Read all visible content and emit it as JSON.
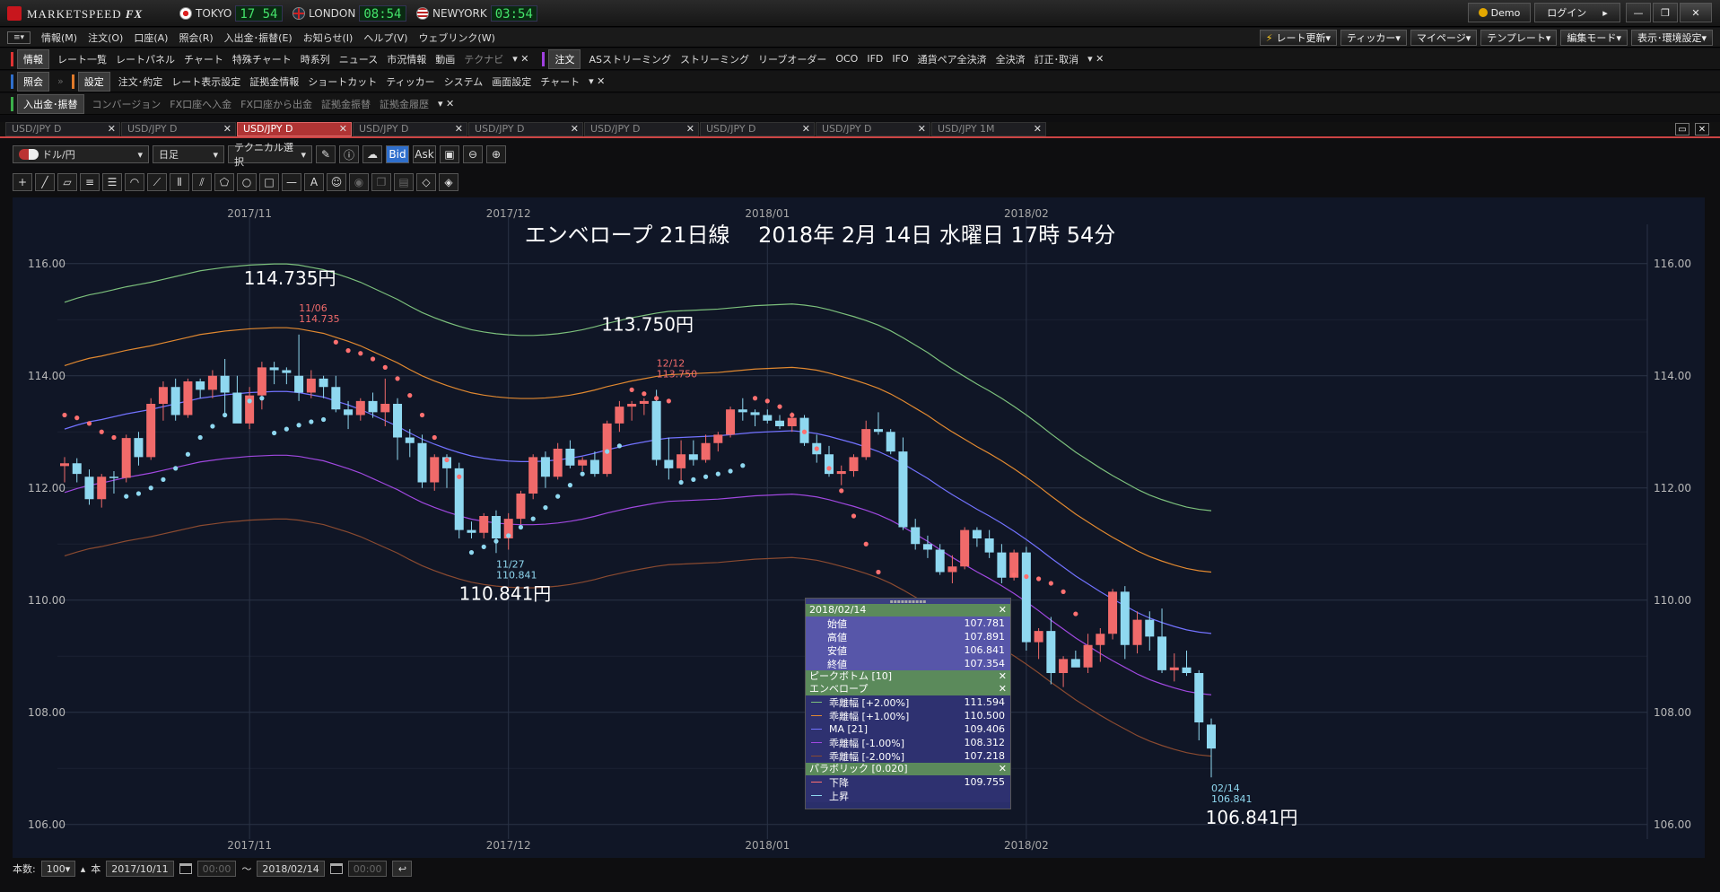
{
  "app": {
    "brand": "MARKETSPEED",
    "brand_suffix": "FX",
    "clocks": [
      {
        "city": "TOKYO",
        "time": "17 54",
        "flag": "japan-flag-icon"
      },
      {
        "city": "LONDON",
        "time": "08:54",
        "flag": "uk-flag-icon"
      },
      {
        "city": "NEWYORK",
        "time": "03:54",
        "flag": "us-flag-icon"
      }
    ],
    "demo_label": "Demo",
    "login_label": "ログイン"
  },
  "menu": {
    "items": [
      "情報(M)",
      "注文(O)",
      "口座(A)",
      "照会(R)",
      "入出金･振替(E)",
      "お知らせ(I)",
      "ヘルプ(V)",
      "ウェブリンク(W)"
    ],
    "right": [
      "レート更新",
      "ティッカー",
      "マイページ",
      "テンプレート",
      "編集モード",
      "表示･環境設定"
    ]
  },
  "toolbar1": {
    "group1": "情報",
    "items1": [
      "レート一覧",
      "レートパネル",
      "チャート",
      "特殊チャート",
      "時系列",
      "ニュース",
      "市況情報",
      "動画",
      "テクナビ"
    ],
    "group2": "注文",
    "items2": [
      "ASストリーミング",
      "ストリーミング",
      "リーブオーダー",
      "OCO",
      "IFD",
      "IFO",
      "通貨ペア全決済",
      "全決済",
      "訂正･取消"
    ]
  },
  "toolbar2": {
    "group1": "照会",
    "group2": "設定",
    "items": [
      "注文･約定",
      "レート表示設定",
      "証拠金情報",
      "ショートカット",
      "ティッカー",
      "システム",
      "画面設定",
      "チャート"
    ]
  },
  "toolbar3": {
    "group1": "入出金･振替",
    "items": [
      "コンバージョン",
      "FX口座へ入金",
      "FX口座から出金",
      "証拠金振替",
      "証拠金履歴"
    ]
  },
  "tabs": [
    {
      "label": "USD/JPY D",
      "active": false
    },
    {
      "label": "USD/JPY D",
      "active": false
    },
    {
      "label": "USD/JPY D",
      "active": true
    },
    {
      "label": "USD/JPY D",
      "active": false
    },
    {
      "label": "USD/JPY D",
      "active": false
    },
    {
      "label": "USD/JPY D",
      "active": false
    },
    {
      "label": "USD/JPY D",
      "active": false
    },
    {
      "label": "USD/JPY D",
      "active": false
    },
    {
      "label": "USD/JPY 1M",
      "active": false
    }
  ],
  "chart_toolbar": {
    "pair": "ドル/円",
    "period": "日足",
    "technical": "テクニカル選択",
    "bid": "Bid",
    "ask": "Ask"
  },
  "chart_data": {
    "type": "candlestick",
    "title": "エンベロープ 21日線　 2018年 2月 14日 水曜日 17時 54分",
    "x_ticks": [
      "2017/11",
      "2017/12",
      "2018/01",
      "2018/02"
    ],
    "y_ticks": [
      "116.00",
      "114.00",
      "112.00",
      "110.00",
      "108.00",
      "106.00"
    ],
    "ylim": [
      105.5,
      116.7
    ],
    "annotations": [
      {
        "text": "114.735円",
        "kind": "big"
      },
      {
        "text": "113.750円",
        "kind": "big"
      },
      {
        "text": "110.841円",
        "kind": "big"
      },
      {
        "text": "106.841円",
        "kind": "big"
      },
      {
        "text": "11/06",
        "value": "114.735"
      },
      {
        "text": "12/12",
        "value": "113.750"
      },
      {
        "text": "11/27",
        "value": "110.841"
      },
      {
        "text": "02/14",
        "value": "106.841"
      }
    ],
    "series_colors": {
      "up": "#f06a6a",
      "down": "#8fd8f0",
      "ma": "#7272ff",
      "env_p2": "#7cc07c",
      "env_p1": "#e08830",
      "env_m1": "#a048e0",
      "env_m2": "#8a4a30",
      "psar_up": "#8fd8f0",
      "psar_down": "#ff7070"
    },
    "ohlc": [
      [
        112.39,
        112.55,
        112.1,
        112.44
      ],
      [
        112.44,
        112.53,
        112.1,
        112.25
      ],
      [
        112.2,
        112.33,
        111.7,
        111.8
      ],
      [
        111.8,
        112.25,
        111.65,
        112.2
      ],
      [
        112.2,
        112.3,
        111.9,
        112.18
      ],
      [
        112.18,
        112.95,
        112.1,
        112.89
      ],
      [
        112.89,
        113.0,
        112.4,
        112.55
      ],
      [
        112.55,
        113.6,
        112.5,
        113.5
      ],
      [
        113.5,
        113.9,
        113.2,
        113.8
      ],
      [
        113.8,
        113.95,
        113.2,
        113.3
      ],
      [
        113.3,
        113.95,
        113.25,
        113.9
      ],
      [
        113.9,
        113.95,
        113.6,
        113.75
      ],
      [
        113.75,
        114.1,
        113.6,
        114.0
      ],
      [
        114.0,
        114.3,
        113.3,
        113.7
      ],
      [
        113.7,
        114.0,
        113.4,
        113.15
      ],
      [
        113.15,
        113.8,
        113.05,
        113.65
      ],
      [
        113.65,
        114.25,
        113.4,
        114.15
      ],
      [
        114.15,
        114.25,
        113.85,
        114.1
      ],
      [
        114.1,
        114.15,
        113.85,
        114.05
      ],
      [
        114.0,
        114.735,
        113.55,
        113.7
      ],
      [
        113.7,
        114.1,
        113.6,
        113.95
      ],
      [
        113.95,
        114.0,
        113.6,
        113.8
      ],
      [
        113.8,
        114.0,
        113.35,
        113.4
      ],
      [
        113.4,
        113.55,
        113.05,
        113.3
      ],
      [
        113.3,
        113.6,
        113.2,
        113.55
      ],
      [
        113.55,
        113.7,
        113.25,
        113.35
      ],
      [
        113.35,
        113.95,
        113.1,
        113.5
      ],
      [
        113.5,
        113.6,
        112.5,
        112.9
      ],
      [
        112.9,
        113.05,
        112.55,
        112.8
      ],
      [
        112.8,
        112.95,
        112.0,
        112.1
      ],
      [
        112.1,
        112.6,
        111.95,
        112.55
      ],
      [
        112.55,
        112.6,
        112.0,
        112.35
      ],
      [
        112.35,
        112.45,
        111.1,
        111.25
      ],
      [
        111.25,
        111.4,
        111.1,
        111.2
      ],
      [
        111.2,
        111.55,
        111.1,
        111.5
      ],
      [
        111.5,
        111.6,
        110.84,
        111.1
      ],
      [
        111.1,
        111.55,
        110.9,
        111.45
      ],
      [
        111.45,
        111.95,
        111.35,
        111.9
      ],
      [
        111.9,
        112.6,
        111.8,
        112.55
      ],
      [
        112.55,
        112.65,
        112.0,
        112.2
      ],
      [
        112.2,
        112.8,
        112.15,
        112.7
      ],
      [
        112.7,
        112.85,
        112.35,
        112.4
      ],
      [
        112.4,
        112.55,
        112.3,
        112.5
      ],
      [
        112.5,
        112.65,
        112.2,
        112.25
      ],
      [
        112.25,
        113.2,
        112.2,
        113.15
      ],
      [
        113.15,
        113.55,
        113.0,
        113.45
      ],
      [
        113.45,
        113.55,
        113.2,
        113.5
      ],
      [
        113.5,
        113.6,
        113.3,
        113.55
      ],
      [
        113.55,
        113.75,
        112.4,
        112.5
      ],
      [
        112.5,
        112.9,
        112.15,
        112.35
      ],
      [
        112.35,
        112.85,
        112.1,
        112.6
      ],
      [
        112.6,
        112.85,
        112.4,
        112.5
      ],
      [
        112.5,
        112.95,
        112.45,
        112.8
      ],
      [
        112.8,
        113.0,
        112.65,
        112.95
      ],
      [
        112.95,
        113.45,
        112.9,
        113.4
      ],
      [
        113.4,
        113.6,
        113.2,
        113.35
      ],
      [
        113.35,
        113.4,
        113.1,
        113.3
      ],
      [
        113.3,
        113.4,
        113.15,
        113.2
      ],
      [
        113.2,
        113.3,
        113.05,
        113.1
      ],
      [
        113.1,
        113.35,
        113.0,
        113.25
      ],
      [
        113.25,
        113.3,
        112.75,
        112.8
      ],
      [
        112.8,
        112.95,
        112.45,
        112.6
      ],
      [
        112.6,
        112.75,
        112.2,
        112.25
      ],
      [
        112.25,
        112.4,
        112.05,
        112.3
      ],
      [
        112.3,
        112.6,
        112.2,
        112.55
      ],
      [
        112.55,
        113.2,
        112.5,
        113.05
      ],
      [
        113.05,
        113.35,
        112.95,
        113.0
      ],
      [
        113.0,
        113.05,
        112.6,
        112.65
      ],
      [
        112.65,
        112.9,
        111.25,
        111.3
      ],
      [
        111.3,
        111.45,
        110.9,
        111.0
      ],
      [
        111.0,
        111.15,
        110.75,
        110.9
      ],
      [
        110.9,
        111.0,
        110.45,
        110.5
      ],
      [
        110.5,
        110.8,
        110.3,
        110.6
      ],
      [
        110.6,
        111.3,
        110.55,
        111.25
      ],
      [
        111.25,
        111.3,
        110.95,
        111.1
      ],
      [
        111.1,
        111.25,
        110.75,
        110.85
      ],
      [
        110.85,
        111.0,
        110.3,
        110.4
      ],
      [
        110.4,
        110.9,
        110.35,
        110.85
      ],
      [
        110.85,
        110.95,
        109.1,
        109.25
      ],
      [
        109.25,
        109.5,
        108.95,
        109.45
      ],
      [
        109.45,
        109.7,
        108.5,
        108.7
      ],
      [
        108.7,
        109.0,
        108.45,
        108.95
      ],
      [
        108.95,
        109.1,
        108.85,
        108.8
      ],
      [
        108.8,
        109.4,
        108.7,
        109.2
      ],
      [
        109.2,
        109.5,
        108.9,
        109.4
      ],
      [
        109.4,
        110.2,
        109.3,
        110.15
      ],
      [
        110.15,
        110.25,
        108.95,
        109.2
      ],
      [
        109.2,
        109.8,
        109.05,
        109.65
      ],
      [
        109.65,
        109.8,
        109.1,
        109.35
      ],
      [
        109.35,
        109.85,
        108.7,
        108.75
      ],
      [
        108.75,
        109.05,
        108.55,
        108.8
      ],
      [
        108.8,
        109.1,
        108.65,
        108.7
      ],
      [
        108.7,
        108.75,
        107.5,
        107.82
      ],
      [
        107.781,
        107.891,
        106.841,
        107.354
      ]
    ],
    "ma21": [
      113.05,
      113.12,
      113.18,
      113.22,
      113.27,
      113.32,
      113.36,
      113.4,
      113.45,
      113.5,
      113.55,
      113.6,
      113.63,
      113.66,
      113.68,
      113.7,
      113.71,
      113.72,
      113.72,
      113.7,
      113.66,
      113.62,
      113.55,
      113.48,
      113.4,
      113.3,
      113.2,
      113.1,
      112.98,
      112.87,
      112.78,
      112.7,
      112.63,
      112.57,
      112.53,
      112.5,
      112.48,
      112.47,
      112.47,
      112.48,
      112.5,
      112.53,
      112.57,
      112.62,
      112.68,
      112.73,
      112.78,
      112.82,
      112.86,
      112.89,
      112.9,
      112.91,
      112.92,
      112.93,
      112.95,
      112.97,
      112.99,
      113.0,
      113.01,
      113.02,
      113.0,
      112.97,
      112.92,
      112.86,
      112.8,
      112.73,
      112.65,
      112.55,
      112.43,
      112.3,
      112.17,
      112.02,
      111.88,
      111.75,
      111.62,
      111.5,
      111.37,
      111.23,
      111.08,
      110.92,
      110.75,
      110.59,
      110.43,
      110.29,
      110.15,
      110.02,
      109.9,
      109.78,
      109.68,
      109.6,
      109.53,
      109.47,
      109.43,
      109.406
    ],
    "psar": [
      {
        "side": "down",
        "values": [
          113.3,
          113.25,
          113.15,
          113.0,
          112.9
        ]
      },
      {
        "side": "up",
        "values": [
          111.85,
          111.9,
          112.0,
          112.15,
          112.35,
          112.6,
          112.9,
          113.1,
          113.3,
          113.45,
          113.55,
          113.6
        ]
      },
      {
        "side": "up",
        "values": [
          112.98,
          113.05,
          113.12,
          113.18,
          113.22
        ]
      },
      {
        "side": "down",
        "values": [
          114.6,
          114.45,
          114.4,
          114.3,
          114.15,
          113.95,
          113.65,
          113.3,
          112.9,
          112.5,
          112.2
        ]
      },
      {
        "side": "up",
        "values": [
          110.85,
          110.95,
          111.05,
          111.15,
          111.3,
          111.45,
          111.65,
          111.85,
          112.05,
          112.25,
          112.45,
          112.65,
          112.75
        ]
      },
      {
        "side": "down",
        "values": [
          113.75,
          113.68,
          113.6,
          113.55
        ]
      },
      {
        "side": "up",
        "values": [
          112.1,
          112.15,
          112.2,
          112.25,
          112.3,
          112.4
        ]
      },
      {
        "side": "down",
        "values": [
          113.6,
          113.55,
          113.45,
          113.3,
          113.0,
          112.7,
          112.35,
          111.95,
          111.5,
          111.0,
          110.5,
          110.0,
          109.6,
          109.35
        ]
      },
      {
        "side": "up",
        "values": [
          108.3,
          108.4,
          108.5,
          108.7,
          108.85,
          109.05,
          109.2
        ]
      },
      {
        "side": "down",
        "values": [
          110.45,
          110.42,
          110.38,
          110.3,
          110.15,
          109.755
        ]
      }
    ]
  },
  "info_panel": {
    "date": "2018/02/14",
    "ohlc": [
      {
        "label": "始値",
        "value": "107.781"
      },
      {
        "label": "高値",
        "value": "107.891"
      },
      {
        "label": "安値",
        "value": "106.841"
      },
      {
        "label": "終値",
        "value": "107.354"
      }
    ],
    "section2": "ピークボトム [10]",
    "section3": "エンベロープ",
    "envelope": [
      {
        "label": "乖離幅 [+2.00%]",
        "value": "111.594",
        "color": "#7cc07c"
      },
      {
        "label": "乖離幅 [+1.00%]",
        "value": "110.500",
        "color": "#e08830"
      },
      {
        "label": "MA [21]",
        "value": "109.406",
        "color": "#7272ff"
      },
      {
        "label": "乖離幅 [-1.00%]",
        "value": "108.312",
        "color": "#a048e0"
      },
      {
        "label": "乖離幅 [-2.00%]",
        "value": "107.218",
        "color": "#8a4a30"
      }
    ],
    "section4": "パラボリック [0.020]",
    "parabolic": [
      {
        "label": "下降",
        "value": "109.755",
        "color": "#ff7070"
      },
      {
        "label": "上昇",
        "value": "",
        "color": "#8fd8f0"
      }
    ]
  },
  "bottom": {
    "count_label": "本数:",
    "count": "100",
    "unit": "本",
    "from_date": "2017/10/11",
    "from_time": "00:00",
    "tilde": "〜",
    "to_date": "2018/02/14",
    "to_time": "00:00"
  }
}
